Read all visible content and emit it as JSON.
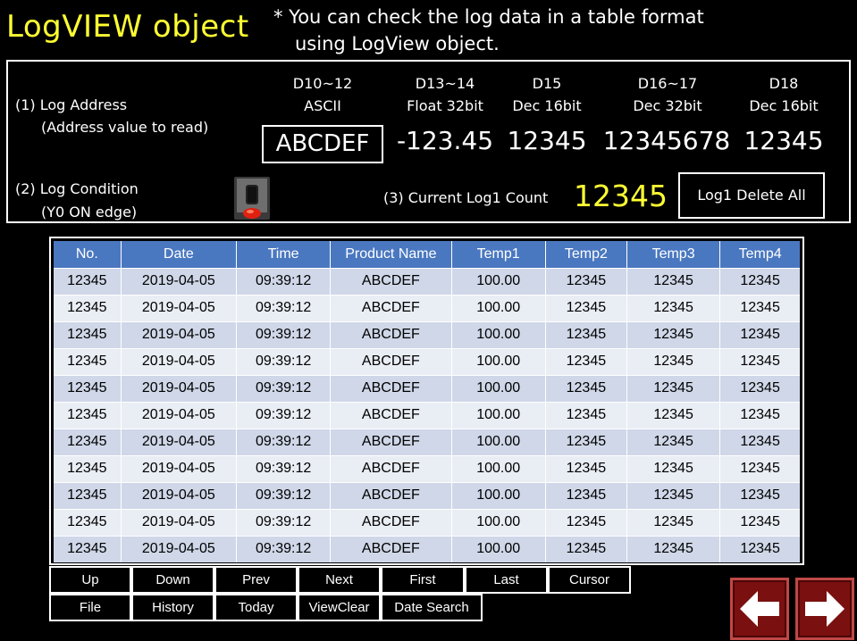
{
  "header": {
    "title": "LogVIEW object",
    "note_line1": "* You can check the log data in a table format",
    "note_line2": "using LogView object."
  },
  "panel": {
    "log_address_label": "(1) Log Address",
    "log_address_sub": "(Address value to read)",
    "log_condition_label": "(2) Log Condition",
    "log_condition_sub": "(Y0 ON edge)",
    "current_count_label": "(3) Current Log1 Count",
    "current_count_value": "12345",
    "delete_all_label": "Log1 Delete All",
    "columns": [
      {
        "addr": "D10~12",
        "type": "ASCII",
        "value": "ABCDEF"
      },
      {
        "addr": "D13~14",
        "type": "Float 32bit",
        "value": "-123.45"
      },
      {
        "addr": "D15",
        "type": "Dec 16bit",
        "value": "12345"
      },
      {
        "addr": "D16~17",
        "type": "Dec 32bit",
        "value": "12345678"
      },
      {
        "addr": "D18",
        "type": "Dec 16bit",
        "value": "12345"
      }
    ]
  },
  "table": {
    "headers": [
      "No.",
      "Date",
      "Time",
      "Product Name",
      "Temp1",
      "Temp2",
      "Temp3",
      "Temp4"
    ],
    "rows": [
      [
        "12345",
        "2019-04-05",
        "09:39:12",
        "ABCDEF",
        "100.00",
        "12345",
        "12345",
        "12345"
      ],
      [
        "12345",
        "2019-04-05",
        "09:39:12",
        "ABCDEF",
        "100.00",
        "12345",
        "12345",
        "12345"
      ],
      [
        "12345",
        "2019-04-05",
        "09:39:12",
        "ABCDEF",
        "100.00",
        "12345",
        "12345",
        "12345"
      ],
      [
        "12345",
        "2019-04-05",
        "09:39:12",
        "ABCDEF",
        "100.00",
        "12345",
        "12345",
        "12345"
      ],
      [
        "12345",
        "2019-04-05",
        "09:39:12",
        "ABCDEF",
        "100.00",
        "12345",
        "12345",
        "12345"
      ],
      [
        "12345",
        "2019-04-05",
        "09:39:12",
        "ABCDEF",
        "100.00",
        "12345",
        "12345",
        "12345"
      ],
      [
        "12345",
        "2019-04-05",
        "09:39:12",
        "ABCDEF",
        "100.00",
        "12345",
        "12345",
        "12345"
      ],
      [
        "12345",
        "2019-04-05",
        "09:39:12",
        "ABCDEF",
        "100.00",
        "12345",
        "12345",
        "12345"
      ],
      [
        "12345",
        "2019-04-05",
        "09:39:12",
        "ABCDEF",
        "100.00",
        "12345",
        "12345",
        "12345"
      ],
      [
        "12345",
        "2019-04-05",
        "09:39:12",
        "ABCDEF",
        "100.00",
        "12345",
        "12345",
        "12345"
      ],
      [
        "12345",
        "2019-04-05",
        "09:39:12",
        "ABCDEF",
        "100.00",
        "12345",
        "12345",
        "12345"
      ]
    ]
  },
  "buttons": {
    "up": "Up",
    "down": "Down",
    "prev": "Prev",
    "next": "Next",
    "first": "First",
    "last": "Last",
    "cursor": "Cursor",
    "file": "File",
    "history": "History",
    "today": "Today",
    "view_clear": "ViewClear",
    "date_search": "Date Search"
  },
  "nav": {
    "back_icon": "arrow-left-icon",
    "forward_icon": "arrow-right-icon"
  },
  "colors": {
    "title": "#ffff33",
    "table_header": "#4a78c0",
    "row_odd": "#cfd7e8",
    "row_even": "#e9edf4",
    "nav_button": "#7a1010"
  }
}
